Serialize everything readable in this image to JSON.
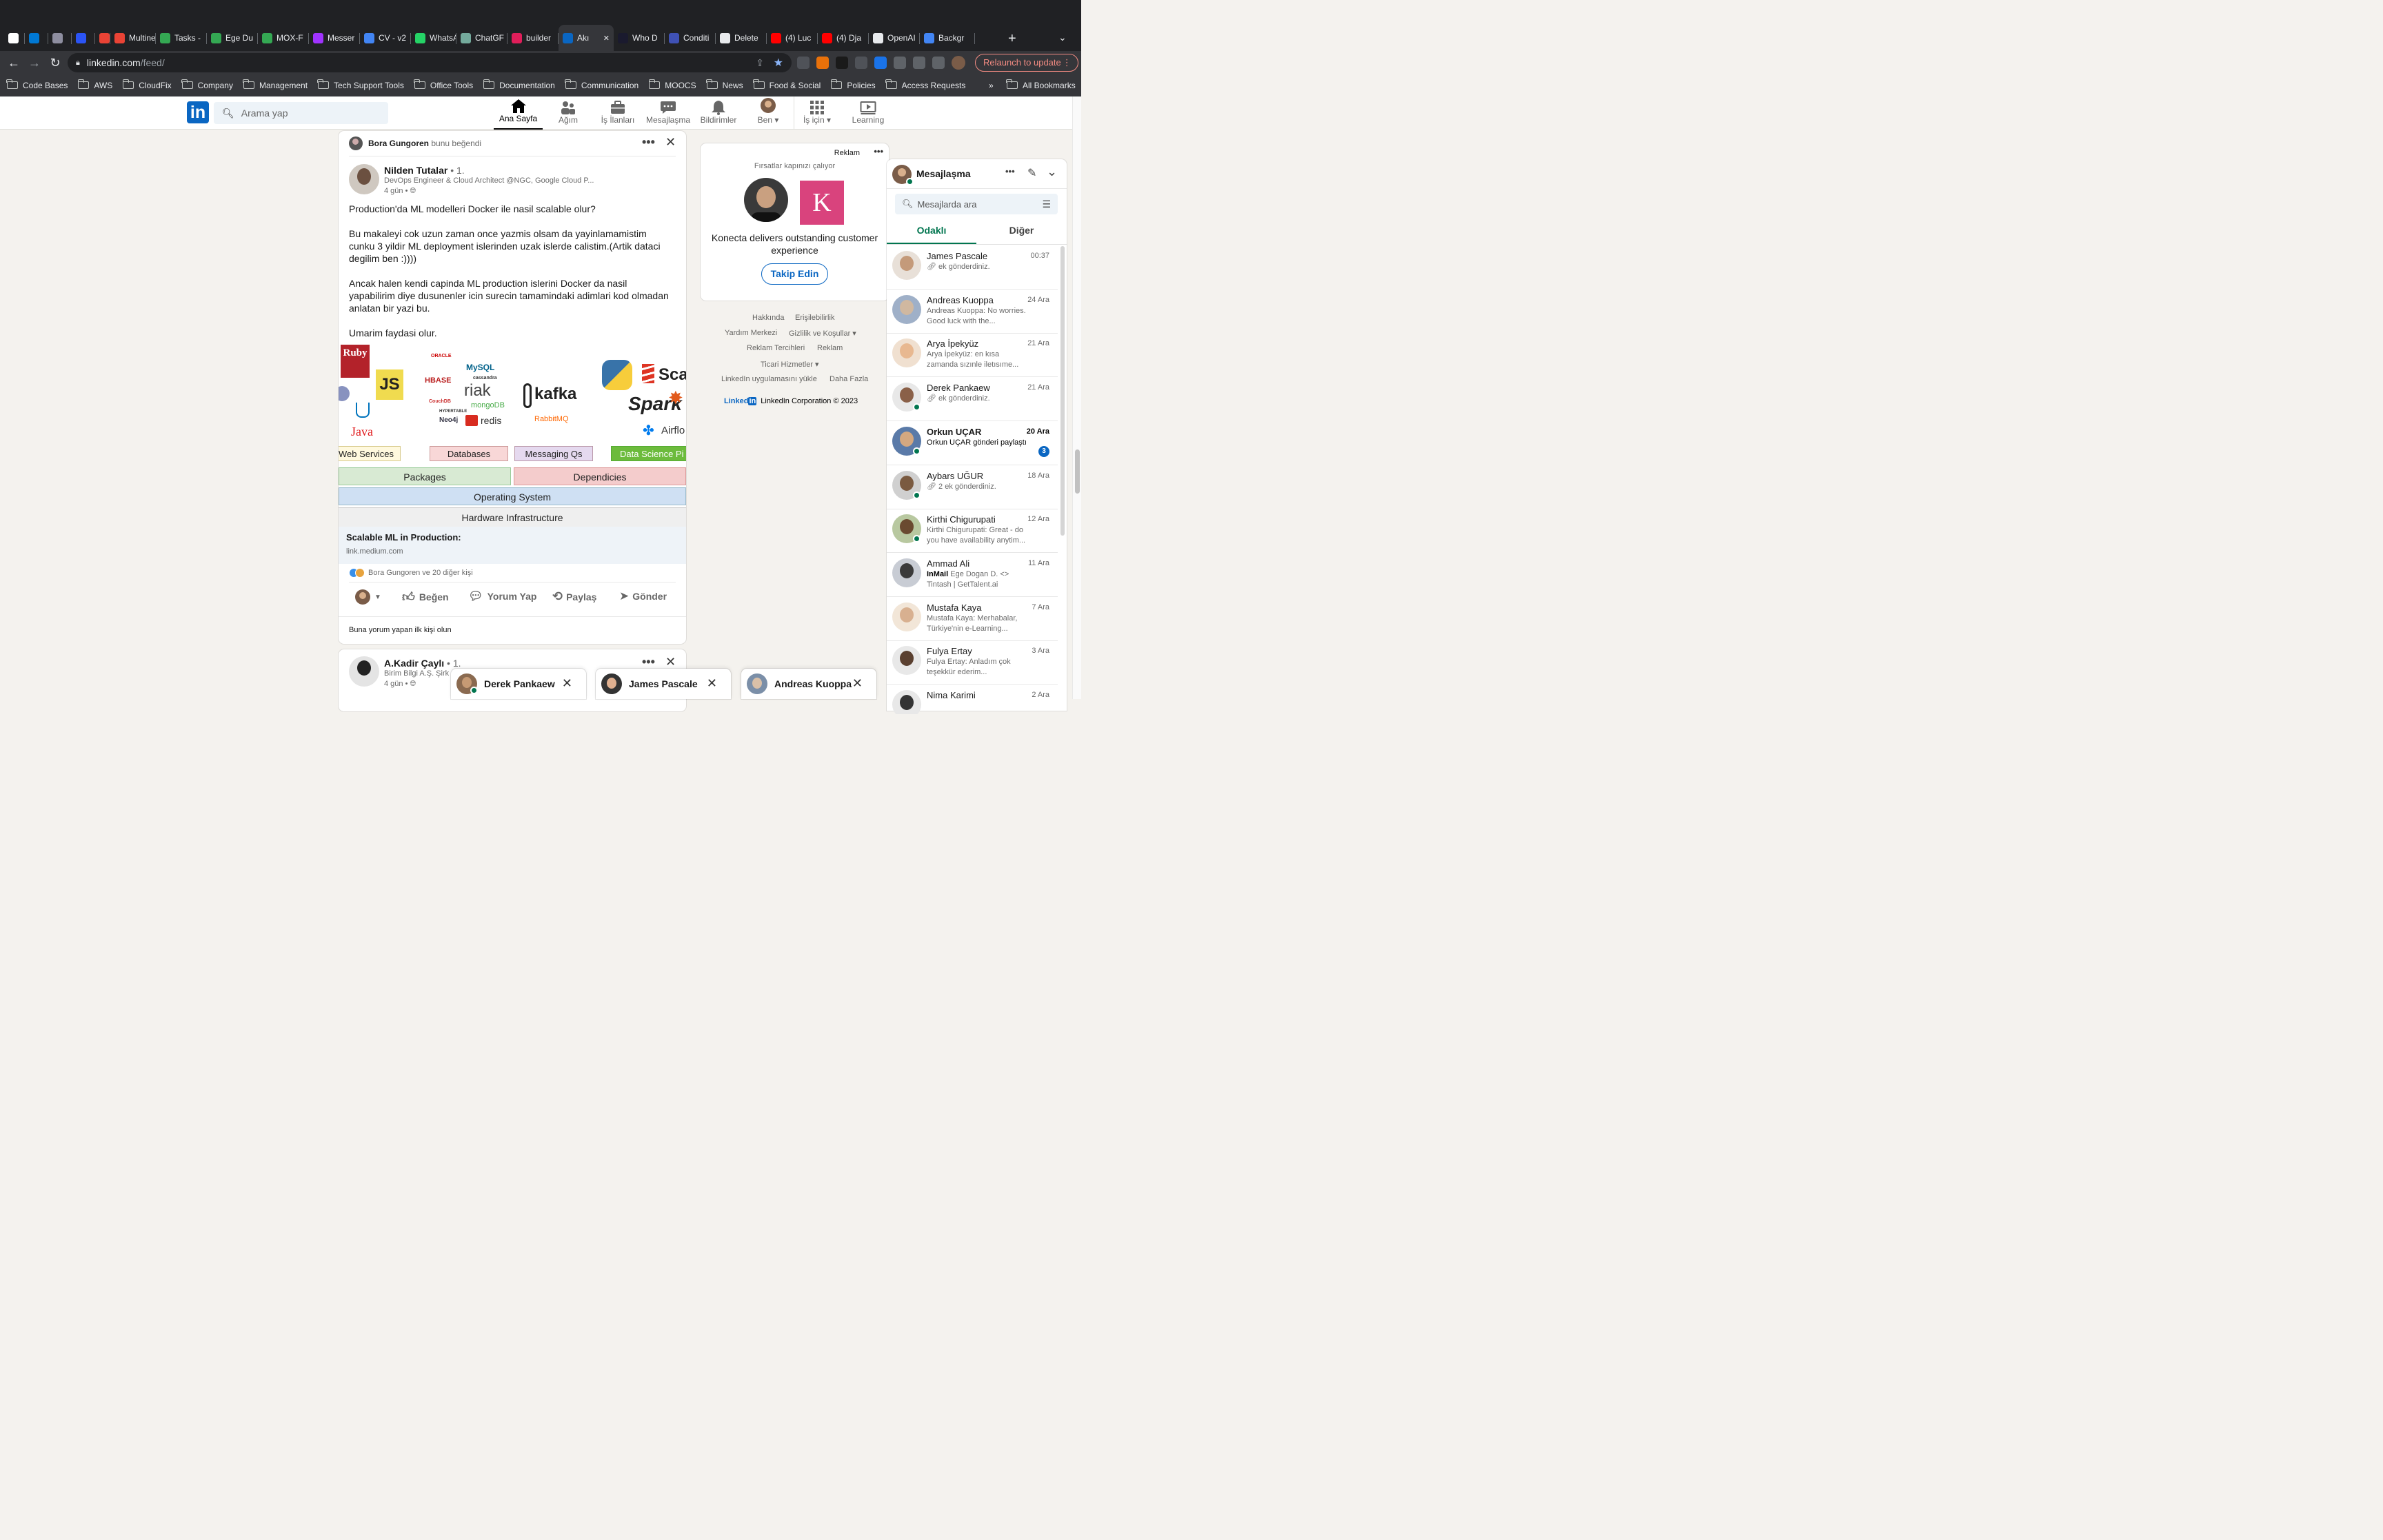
{
  "browser": {
    "tabs": [
      {
        "label": "",
        "color": "#ffffff"
      },
      {
        "label": "",
        "color": "#0078d4"
      },
      {
        "label": "",
        "color": "#8e8ea0"
      },
      {
        "label": "",
        "color": "#2b54f5"
      },
      {
        "label": "",
        "color": "#ea4335"
      },
      {
        "label": "Multine",
        "color": "#ea4335"
      },
      {
        "label": "Tasks -",
        "color": "#34a853"
      },
      {
        "label": "Ege Du",
        "color": "#34a853"
      },
      {
        "label": "MOX-F",
        "color": "#34a853"
      },
      {
        "label": "Messer",
        "color": "#a033ff"
      },
      {
        "label": "CV - v2",
        "color": "#4285f4"
      },
      {
        "label": "WhatsA",
        "color": "#25d366"
      },
      {
        "label": "ChatGF",
        "color": "#74aa9c"
      },
      {
        "label": "builder",
        "color": "#e01e5a"
      },
      {
        "label": "Akı",
        "color": "#0a66c2",
        "active": true
      },
      {
        "label": "Who D",
        "color": "#1a1a2e"
      },
      {
        "label": "Conditi",
        "color": "#3f51b5"
      },
      {
        "label": "Delete",
        "color": "#e8eaed"
      },
      {
        "label": "(4) Luc",
        "color": "#ff0000"
      },
      {
        "label": "(4) Dja",
        "color": "#ff0000"
      },
      {
        "label": "OpenAI",
        "color": "#e8eaed"
      },
      {
        "label": "Backgr",
        "color": "#4285f4"
      }
    ],
    "url_host": "linkedin.com",
    "url_path": "/feed/",
    "relaunch_label": "Relaunch to update",
    "bookmarks": [
      "Code Bases",
      "AWS",
      "CloudFix",
      "Company",
      "Management",
      "Tech Support Tools",
      "Office Tools",
      "Documentation",
      "Communication",
      "MOOCS",
      "News",
      "Food & Social",
      "Policies",
      "Access Requests"
    ],
    "bookmarks_more": "»",
    "all_bookmarks": "All Bookmarks"
  },
  "linkedin": {
    "logo": "in",
    "search_placeholder": "Arama yap",
    "nav": {
      "home": "Ana Sayfa",
      "network": "Ağım",
      "jobs": "İş İlanları",
      "messaging": "Mesajlaşma",
      "notifications": "Bildirimler",
      "me": "Ben",
      "business": "İş için",
      "learning": "Learning"
    }
  },
  "post": {
    "liker_name": "Bora Gungoren",
    "liker_action": "bunu beğendi",
    "author_name": "Nilden Tutalar",
    "author_degree": "• 1.",
    "author_headline": "DevOps Engineer & Cloud Architect @NGC, Google Cloud P...",
    "time": "4 gün •",
    "paragraphs": [
      "Production'da ML modelleri Docker ile nasil scalable olur?",
      "Bu makaleyi cok uzun zaman once yazmis olsam da yayinlamamistim cunku 3 yildir ML deployment islerinden uzak islerde calistim.(Artik dataci degilim ben :))))",
      "Ancak halen kendi capinda ML production islerini Docker da nasil yapabilirim diye dusunenler icin surecin tamamindaki adimlari kod olmadan anlatan bir yazi bu.",
      "Umarim faydasi olur."
    ],
    "image": {
      "logos": {
        "ruby": "Ruby",
        "js": "JS",
        "java": "Java",
        "oracle": "ORACLE",
        "mysql": "MySQL",
        "hbase": "HBASE",
        "cassandra": "cassandra",
        "riak": "riak",
        "couchdb": "CouchDB",
        "mongodb": "mongoDB",
        "hypertable": "HYPERTABLE",
        "neo4j": "Neo4j",
        "redis": "redis",
        "kafka": "kafka",
        "rabbitmq": "RabbitMQ",
        "scala": "Sca",
        "spark": "Spark",
        "airflow": "Airflo"
      },
      "categories": [
        "Web Services",
        "Databases",
        "Messaging Qs",
        "Data Science Pi"
      ],
      "packages": "Packages",
      "dependencies": "Dependicies",
      "os": "Operating System",
      "hardware": "Hardware Infrastructure"
    },
    "link_title": "Scalable ML in Production:",
    "link_domain": "link.medium.com",
    "reactions": "Bora Gungoren ve 20 diğer kişi",
    "actions": {
      "like": "Beğen",
      "comment": "Yorum Yap",
      "share": "Paylaş",
      "send": "Gönder"
    },
    "first_comment": "Buna yorum yapan ilk kişi olun"
  },
  "post2": {
    "author_name": "A.Kadir Çaylı",
    "author_degree": "• 1.",
    "author_headline": "Birim Bilgi A.Ş. Şirk",
    "time": "4 gün •"
  },
  "ad": {
    "label": "Reklam",
    "tagline": "Fırsatlar kapınızı çalıyor",
    "brand_letter": "K",
    "headline": "Konecta delivers outstanding customer experience",
    "follow": "Takip Edin"
  },
  "footer": {
    "links": [
      "Hakkında",
      "Erişilebilirlik",
      "Yardım Merkezi",
      "Gizlilik ve Koşullar",
      "Reklam Tercihleri",
      "Reklam",
      "Ticari Hizmetler",
      "LinkedIn uygulamasını yükle",
      "Daha Fazla"
    ],
    "brand": "Linked",
    "brand_in": "in",
    "copyright": "LinkedIn Corporation © 2023"
  },
  "messaging": {
    "title": "Mesajlaşma",
    "search_placeholder": "Mesajlarda ara",
    "tab_focused": "Odaklı",
    "tab_other": "Diğer",
    "conversations": [
      {
        "name": "James Pascale",
        "time": "00:37",
        "preview": "ek gönderdiniz.",
        "attach": true
      },
      {
        "name": "Andreas Kuoppa",
        "time": "24 Ara",
        "preview": "Andreas Kuoppa: No worries. Good luck with the..."
      },
      {
        "name": "Arya İpekyüz",
        "time": "21 Ara",
        "preview": "Arya İpekyüz: en kısa zamanda sızınle iletısıme..."
      },
      {
        "name": "Derek Pankaew",
        "time": "21 Ara",
        "preview": "ek gönderdiniz.",
        "attach": true,
        "online": true
      },
      {
        "name": "Orkun UÇAR",
        "time": "20 Ara",
        "preview": "Orkun UÇAR gönderi paylaştı",
        "unread": "3",
        "online": true
      },
      {
        "name": "Aybars UĞUR",
        "time": "18 Ara",
        "preview": "2 ek gönderdiniz.",
        "attach": true,
        "online": true
      },
      {
        "name": "Kirthi Chigurupati",
        "time": "12 Ara",
        "preview": "Kirthi Chigurupati: Great - do you have availability anytim...",
        "online": true
      },
      {
        "name": "Ammad Ali",
        "time": "11 Ara",
        "preview_bold": "InMail",
        "preview": "Ege Dogan D. <> Tintash | GetTalent.ai"
      },
      {
        "name": "Mustafa Kaya",
        "time": "7 Ara",
        "preview": "Mustafa Kaya: Merhabalar, Türkiye'nin e-Learning..."
      },
      {
        "name": "Fulya Ertay",
        "time": "3 Ara",
        "preview": "Fulya Ertay: Anladım çok teşekkür ederim..."
      },
      {
        "name": "Nima Karimi",
        "time": "2 Ara",
        "preview": ""
      }
    ]
  },
  "chat_windows": [
    "Derek Pankaew",
    "James Pascale",
    "Andreas Kuoppa"
  ]
}
